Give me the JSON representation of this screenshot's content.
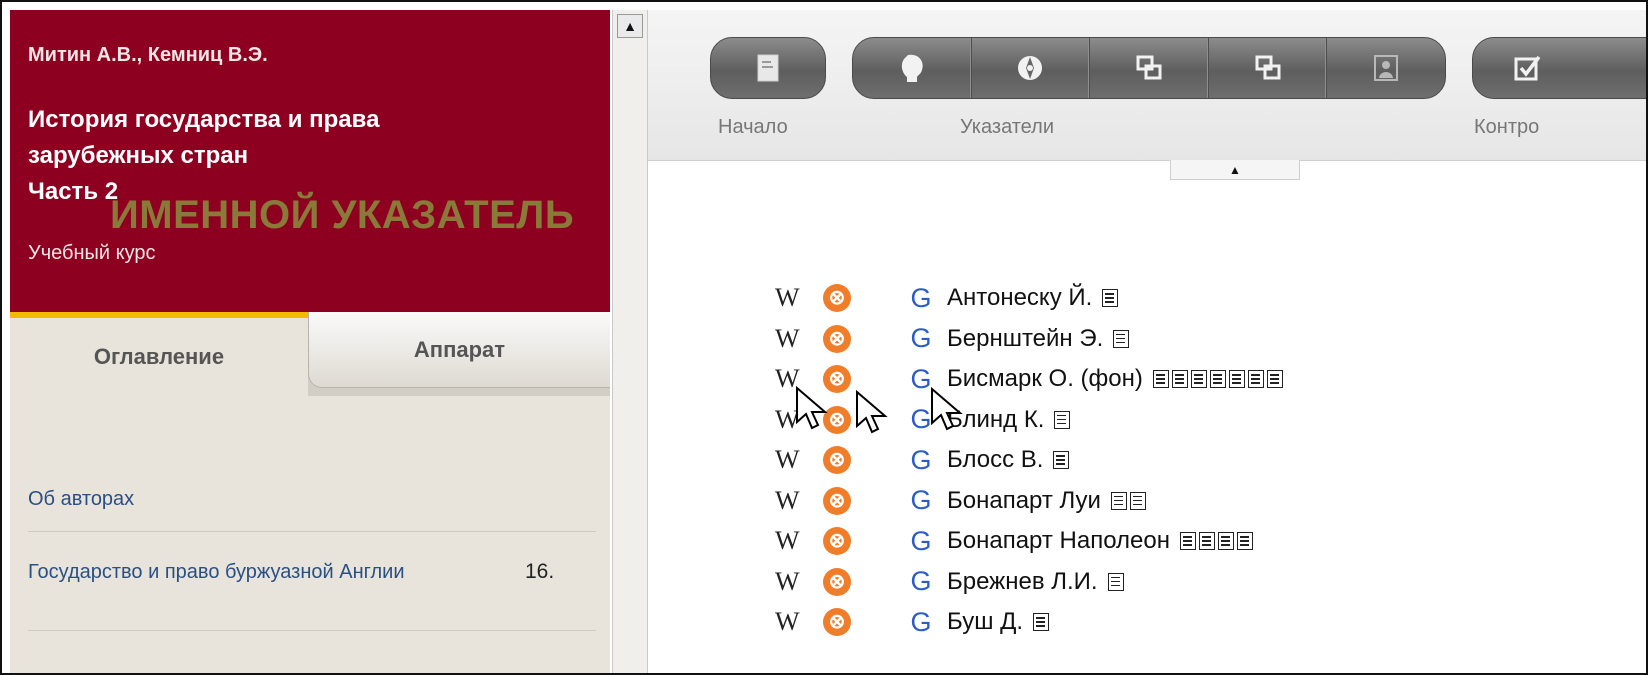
{
  "sidebar": {
    "authors": "Митин А.В., Кемниц В.Э.",
    "title_lines": [
      "История государства и права",
      "зарубежных стран",
      "Часть 2"
    ],
    "subtitle": "Учебный курс",
    "tabs": [
      {
        "label": "Оглавление",
        "active": true
      },
      {
        "label": "Аппарат",
        "active": false
      }
    ],
    "toc": [
      {
        "label": "Об авторах"
      },
      {
        "label": "Государство и право буржуазной Англии",
        "number": "16."
      }
    ]
  },
  "toolbar": {
    "groups": [
      {
        "label": "Начало",
        "icons": [
          "document-icon"
        ]
      },
      {
        "label": "Указатели",
        "icons": [
          "person-head-icon",
          "compass-icon",
          "windows-icon",
          "windows-icon-2",
          "portrait-icon"
        ]
      },
      {
        "label": "Контро",
        "icons": [
          "checkbox-icon"
        ]
      }
    ]
  },
  "index": {
    "title": "ИМЕННОЙ УКАЗАТЕЛЬ",
    "w_glyph": "W",
    "x_glyph": "⊗",
    "g_glyph": "G",
    "entries": [
      {
        "name": "Антонеску Й.",
        "docs": 1
      },
      {
        "name": "Бернштейн Э.",
        "docs": 1
      },
      {
        "name": "Бисмарк О. (фон)",
        "docs": 7
      },
      {
        "name": "Блинд К.",
        "docs": 1
      },
      {
        "name": "Блосс В.",
        "docs": 1
      },
      {
        "name": "Бонапарт Луи",
        "docs": 2
      },
      {
        "name": "Бонапарт Наполеон",
        "docs": 4
      },
      {
        "name": "Брежнев Л.И.",
        "docs": 1
      },
      {
        "name": "Буш Д.",
        "docs": 1
      }
    ]
  },
  "colors": {
    "brand": "#8e0020",
    "tab_accent": "#f5b800",
    "index_title": "#8a7a3a",
    "link": "#2a4f83",
    "google": "#2b5bc7",
    "orange": "#ef7d2a"
  }
}
